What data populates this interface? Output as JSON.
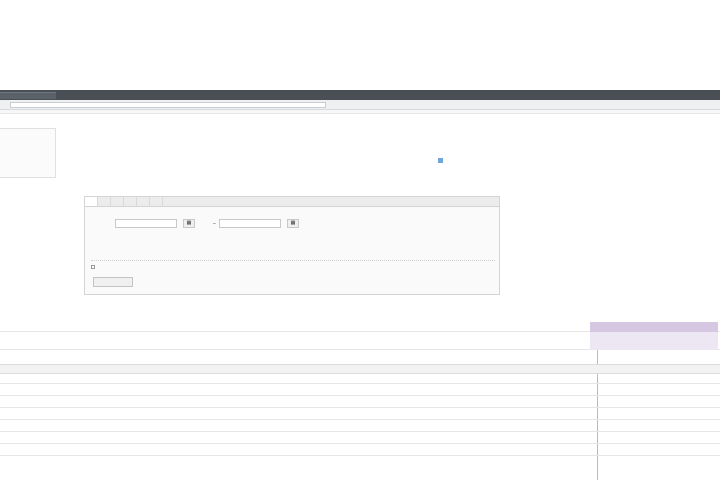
{
  "browser": {
    "tab_title": "",
    "url": ""
  },
  "sidebar": {
    "items": [
      {
        "label": ""
      },
      {
        "label": ""
      }
    ]
  },
  "page": {
    "title": "",
    "title_link": "",
    "meta": {
      "row1_label": "",
      "row1_value": "",
      "row2_label": "",
      "row2_value": "",
      "row3_label": "",
      "row3_value": "",
      "row3_link": ""
    },
    "legend_label": ""
  },
  "filter": {
    "tabs": [
      "",
      "",
      "",
      "",
      "",
      ""
    ],
    "period_label": "",
    "date_from": "",
    "date_to": "",
    "quick_links": [
      "",
      "",
      "",
      "",
      "",
      ""
    ],
    "hint": "",
    "checkbox_label": "",
    "apply_label": ""
  },
  "table": {
    "headers": [
      "",
      "",
      "",
      "",
      "",
      "",
      "",
      "",
      ""
    ],
    "total_row": [
      "",
      "",
      "",
      "",
      "",
      "",
      "",
      "",
      ""
    ],
    "section_label": "",
    "sub_headers": [
      "",
      "",
      "",
      "",
      "",
      "",
      "",
      ""
    ],
    "rows": [
      [
        "",
        "",
        "",
        "",
        "",
        "",
        "",
        ""
      ],
      [
        "",
        "",
        "",
        "",
        "",
        "",
        "",
        ""
      ],
      [
        "",
        "",
        "",
        "",
        "",
        "",
        "",
        ""
      ],
      [
        "",
        "",
        "",
        "",
        "",
        "",
        "",
        ""
      ],
      [
        "",
        "",
        "",
        "",
        "",
        "",
        "",
        ""
      ],
      [
        "",
        "",
        "",
        "",
        "",
        "",
        "",
        ""
      ]
    ]
  },
  "colors": {
    "chrome_dark": "#4a4f55",
    "link": "#3b6fb6",
    "highlight_column": "#ede6f3"
  }
}
